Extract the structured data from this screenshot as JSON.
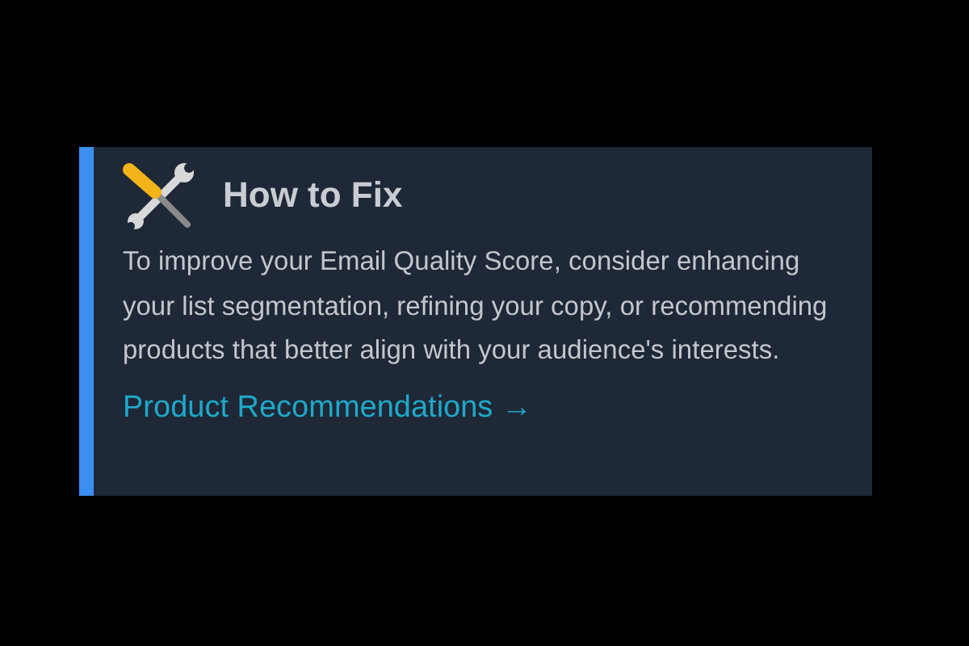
{
  "card": {
    "title": "How to Fix",
    "body": "To improve your Email Quality Score, consider enhancing your list segmentation, refining your copy, or recommending products that better align with your audience's interests.",
    "link": "Product Recommendations →"
  }
}
